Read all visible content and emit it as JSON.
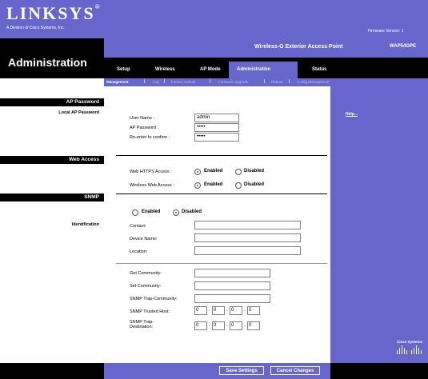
{
  "brand": {
    "logo": "LINKSYS",
    "logo_trademark": "®",
    "subtitle": "A Division of Cisco Systems, Inc.",
    "firmware": "Firmware Version: 1"
  },
  "header": {
    "section_title": "Administration",
    "product_name": "Wireless-G Exterior Access Point",
    "model": "WAP54GPE"
  },
  "tabs": [
    {
      "label": "Setup"
    },
    {
      "label": "Wireless"
    },
    {
      "label": "AP Mode"
    },
    {
      "label": "Administration"
    },
    {
      "label": "Status"
    }
  ],
  "subtabs": [
    {
      "label": "Management"
    },
    {
      "label": "Log"
    },
    {
      "label": "Factory Default"
    },
    {
      "label": "Firmware Upgrade"
    },
    {
      "label": "Reboot"
    },
    {
      "label": "Config Management"
    }
  ],
  "sections": {
    "ap_password": "AP Password",
    "local_ap_password": "Local AP Password",
    "web_access": "Web Access",
    "snmp": "SNMP",
    "identification": "Identification"
  },
  "password": {
    "user_name_label": "User Name :",
    "user_name_value": "admin",
    "ap_password_label": "AP Password :",
    "ap_password_value": "•••••",
    "reenter_label": "Re-enter to confirm :",
    "reenter_value": "•••••"
  },
  "web_access": {
    "https_label": "Web HTTPS Access :",
    "wireless_label": "Wireless Web Access :",
    "enabled": "Enabled",
    "disabled": "Disabled",
    "https_selected": "Enabled",
    "wireless_selected": "Enabled"
  },
  "snmp": {
    "enabled": "Enabled",
    "disabled": "Disabled",
    "selected": "Disabled",
    "contact_label": "Contact:",
    "device_name_label": "Device Name:",
    "location_label": "Location:",
    "get_community_label": "Get Community:",
    "set_community_label": "Set Community:",
    "trap_community_label": "SNMP Trap-Community:",
    "trusted_host_label": "SNMP Trusted Host:",
    "trap_destination_label_1": "SNMP Trap-",
    "trap_destination_label_2": "Destination:",
    "trusted_host_ip": [
      "0",
      "0",
      "0",
      "0"
    ],
    "trap_destination_ip": [
      "0",
      "0",
      "0",
      "0"
    ]
  },
  "help": {
    "label": "Help..."
  },
  "buttons": {
    "save": "Save Settings",
    "cancel": "Cancel Changes"
  },
  "cisco": {
    "label": "Cisco Systems"
  },
  "colors": {
    "accent": "#6666cc",
    "black": "#000000",
    "radio_checked": "#2a7a2a"
  }
}
